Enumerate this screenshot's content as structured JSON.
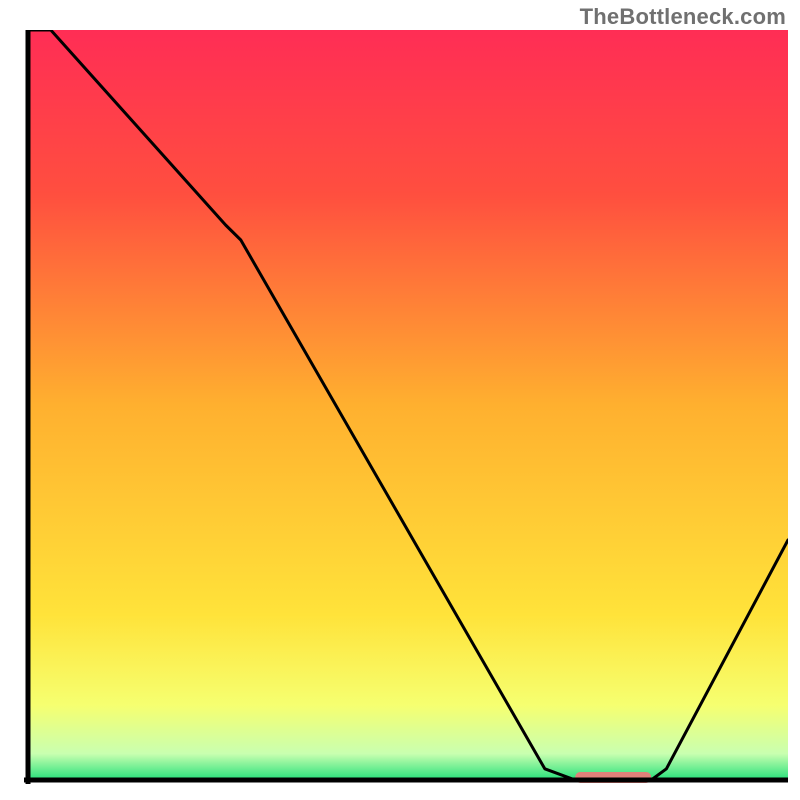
{
  "watermark": "TheBottleneck.com",
  "chart_data": {
    "type": "line",
    "title": "",
    "xlabel": "",
    "ylabel": "",
    "xlim": [
      0,
      100
    ],
    "ylim": [
      0,
      100
    ],
    "x": [
      0,
      3,
      26,
      28,
      68,
      72,
      82,
      84,
      100
    ],
    "values": [
      100,
      100,
      74,
      72,
      1.5,
      0,
      0,
      1.5,
      32
    ],
    "optimum_band": {
      "x_start": 72,
      "x_end": 82,
      "color": "#e1817a"
    },
    "gradient_stops": [
      {
        "offset": 0.0,
        "color": "#ff2d55"
      },
      {
        "offset": 0.22,
        "color": "#ff4f3f"
      },
      {
        "offset": 0.5,
        "color": "#ffb02f"
      },
      {
        "offset": 0.78,
        "color": "#ffe33a"
      },
      {
        "offset": 0.9,
        "color": "#f6ff70"
      },
      {
        "offset": 0.965,
        "color": "#c9ffb0"
      },
      {
        "offset": 1.0,
        "color": "#25e07a"
      }
    ]
  }
}
